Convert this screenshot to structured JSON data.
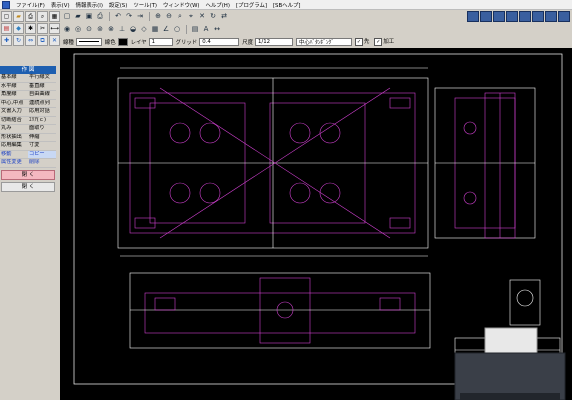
{
  "menu": {
    "items": [
      "ファイル(F)",
      "表示(V)",
      "情報表示(I)",
      "設定(S)",
      "ツール(T)",
      "ウィンドウ(W)",
      "ヘルプ(H)",
      "[プログラム]",
      "[SBヘルプ]"
    ]
  },
  "toolbar_left": {
    "icons": [
      "new-file-icon",
      "folder-icon",
      "printer-icon",
      "zoom-icon",
      "grid-icon",
      "layer-icon",
      "cube-icon",
      "settings-icon",
      "cut-icon",
      "measure-icon",
      "move-icon",
      "rotate-icon"
    ]
  },
  "properties": {
    "line_type_label": "線種",
    "line_color_label": "線色",
    "layer_label": "レイヤ",
    "layer_value": "1",
    "grid_label": "グリッド",
    "grid_value": "0.4",
    "scale_label": "尺度",
    "scale_value": "1/12",
    "snap_value": "中心ﾊﾞﾀﾝﾎﾞﾝｸﾞ",
    "check1_label": "先",
    "check2_label": "加工"
  },
  "sidebar": {
    "header": "作 図",
    "items": [
      {
        "left": "基本線",
        "right": "平行線文"
      },
      {
        "left": "水平線",
        "right": "垂直線"
      },
      {
        "left": "角度線",
        "right": "自由曲線"
      },
      {
        "left": "中心,中点",
        "right": "連続点列"
      },
      {
        "left": "文書入力",
        "right": "応用対話"
      },
      {
        "left": "切断結合",
        "right": "ｴﾘｱ(ｃ)"
      },
      {
        "left": "丸み",
        "right": "面取り"
      },
      {
        "left": "形状抽出",
        "right": "伸縮"
      },
      {
        "left": "応用編集",
        "right": "寸変"
      },
      {
        "left": "移動",
        "right": "コピー"
      },
      {
        "left": "属性変更",
        "right": "削除"
      }
    ],
    "button_red": "閉 く",
    "button_gray": "閉 く"
  },
  "colors": {
    "canvas_bg": "#000000",
    "drawing_primary": "#d040d0",
    "drawing_secondary": "#ffffff",
    "sidebar_header": "#1e5fb0",
    "accent_button": "#f4b8c0"
  }
}
